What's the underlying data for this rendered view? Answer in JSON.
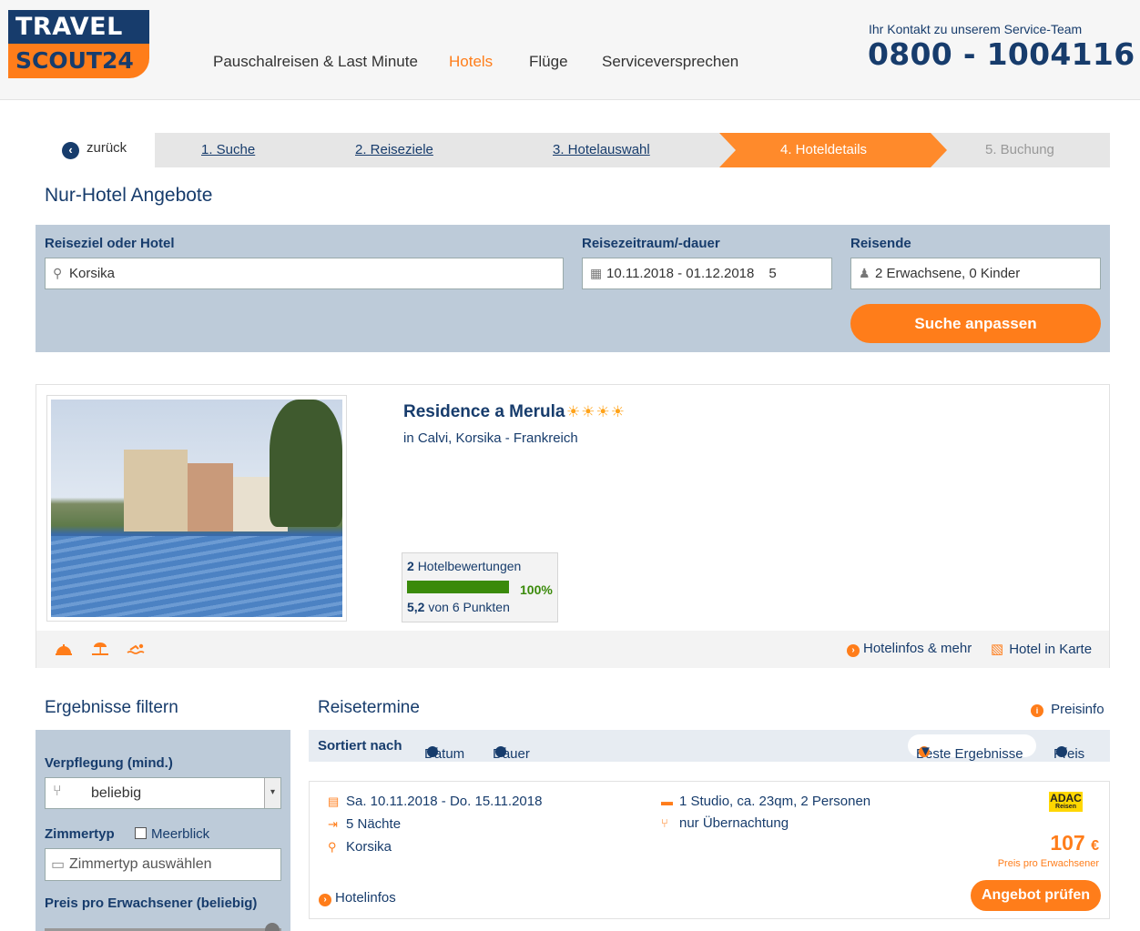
{
  "logo": {
    "line1": "TRAVEL",
    "line2": "SCOUT24"
  },
  "nav": [
    {
      "label": "Pauschalreisen & Last Minute",
      "active": false
    },
    {
      "label": "Hotels",
      "active": true
    },
    {
      "label": "Flüge",
      "active": false
    },
    {
      "label": "Serviceversprechen",
      "active": false
    }
  ],
  "contact": {
    "label": "Ihr Kontakt zu unserem Service-Team",
    "phone": "0800 - 1004116"
  },
  "steps": {
    "back": "zurück",
    "items": [
      "1. Suche",
      "2. Reiseziele",
      "3. Hotelauswahl",
      "4. Hoteldetails",
      "5. Buchung"
    ],
    "current_index": 3
  },
  "page_title": "Nur-Hotel Angebote",
  "search": {
    "dest_label": "Reiseziel oder Hotel",
    "dest_value": "Korsika",
    "date_label": "Reisezeitraum/-dauer",
    "date_value": "10.11.2018 - 01.12.2018",
    "duration_value": "5",
    "travellers_label": "Reisende",
    "travellers_value": "2 Erwachsene, 0 Kinder",
    "submit": "Suche anpassen"
  },
  "hotel": {
    "name": "Residence a Merula",
    "stars": "☀☀☀☀",
    "location": "in Calvi, Korsika - Frankreich",
    "rating": {
      "count": "2",
      "count_label": "Hotelbewertungen",
      "recommend_pct": "100%",
      "recommend_fraction": 1.0,
      "score": "5,2",
      "score_suffix": "von 6 Punkten"
    },
    "links": {
      "info": "Hotelinfos & mehr",
      "map": "Hotel in Karte"
    }
  },
  "filter": {
    "title": "Ergebnisse filtern",
    "board_label": "Verpflegung (mind.)",
    "board_value": "beliebig",
    "room_label": "Zimmertyp",
    "room_checkbox": "Meerblick",
    "room_placeholder": "Zimmertyp auswählen",
    "price_label": "Preis pro Erwachsener (beliebig)"
  },
  "results": {
    "title": "Reisetermine",
    "price_info": "Preisinfo",
    "sort_label": "Sortiert nach",
    "sort_options": [
      "Datum",
      "Dauer",
      "Beste Ergebnisse",
      "Preis"
    ],
    "offer": {
      "dates": "Sa. 10.11.2018 - Do. 15.11.2018",
      "nights": "5 Nächte",
      "region": "Korsika",
      "room": "1 Studio, ca. 23qm, 2 Personen",
      "board": "nur Übernachtung",
      "provider": "ADAC",
      "provider_sub": "Reisen",
      "price": "107",
      "currency": "€",
      "price_note": "Preis pro Erwachsener",
      "info_link": "Hotelinfos",
      "cta": "Angebot prüfen"
    }
  },
  "colors": {
    "navy": "#173c6c",
    "orange": "#ff7d1a",
    "panel": "#bdcbd9",
    "green": "#3a8a0a"
  }
}
